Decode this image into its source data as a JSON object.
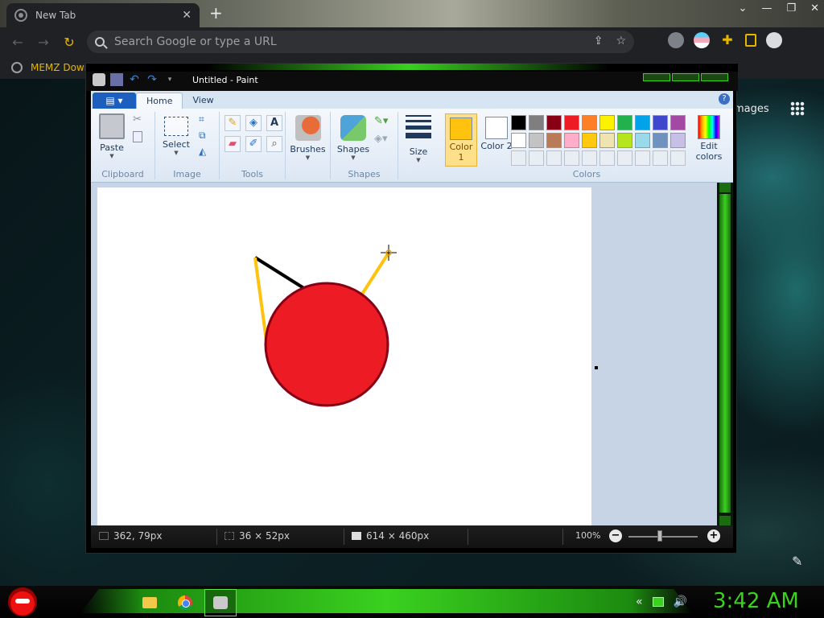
{
  "chrome": {
    "tab_title": "New Tab",
    "tab_close": "✕",
    "new_tab": "+",
    "window_controls": [
      "⌄",
      "—",
      "❐",
      "✕"
    ],
    "nav": {
      "back": "←",
      "forward": "→",
      "reload": "↻"
    },
    "omnibox_placeholder": "Search Google or type a URL",
    "bookmark": "MEMZ Down",
    "images_link": "mages"
  },
  "paint": {
    "window_title": "Untitled - Paint",
    "qat": {
      "undo": "↶",
      "redo": "↷",
      "customize": "▾"
    },
    "file_menu": "▤ ▾",
    "tabs": [
      "Home",
      "View"
    ],
    "help": "?",
    "groups": {
      "clipboard": {
        "label": "Clipboard",
        "paste": "Paste"
      },
      "image": {
        "label": "Image",
        "select": "Select"
      },
      "tools": {
        "label": "Tools"
      },
      "brushes": {
        "label": "Brushes"
      },
      "shapes": {
        "label": "Shapes",
        "shapes_btn": "Shapes"
      },
      "size": {
        "label": "Size"
      },
      "colors": {
        "label": "Colors",
        "color1_label": "Color 1",
        "color2_label": "Color 2",
        "edit_colors": "Edit colors",
        "color1": "#ffc20e",
        "color2": "#ffffff",
        "palette_row1": [
          "#000000",
          "#7f7f7f",
          "#880015",
          "#ed1c24",
          "#ff7f27",
          "#fff200",
          "#22b14c",
          "#00a2e8",
          "#3f48cc",
          "#a349a4"
        ],
        "palette_row2": [
          "#ffffff",
          "#c3c3c3",
          "#b97a57",
          "#ffaec9",
          "#ffc90e",
          "#efe4b0",
          "#b5e61d",
          "#99d9ea",
          "#7092be",
          "#c8bfe7"
        ]
      }
    },
    "drawing": {
      "circle_fill": "#ed1c24",
      "circle_stroke": "#880015",
      "line_black": "#000000",
      "line_yellow": "#ffc20e"
    },
    "status": {
      "cursor_pos": "362, 79px",
      "selection_size": "36 × 52px",
      "image_size": "614 × 460px",
      "zoom": "100%",
      "zoom_minus": "−",
      "zoom_plus": "+"
    }
  },
  "taskbar": {
    "clock": "3:42 AM",
    "tray_icons": [
      "«",
      "🔊"
    ]
  }
}
